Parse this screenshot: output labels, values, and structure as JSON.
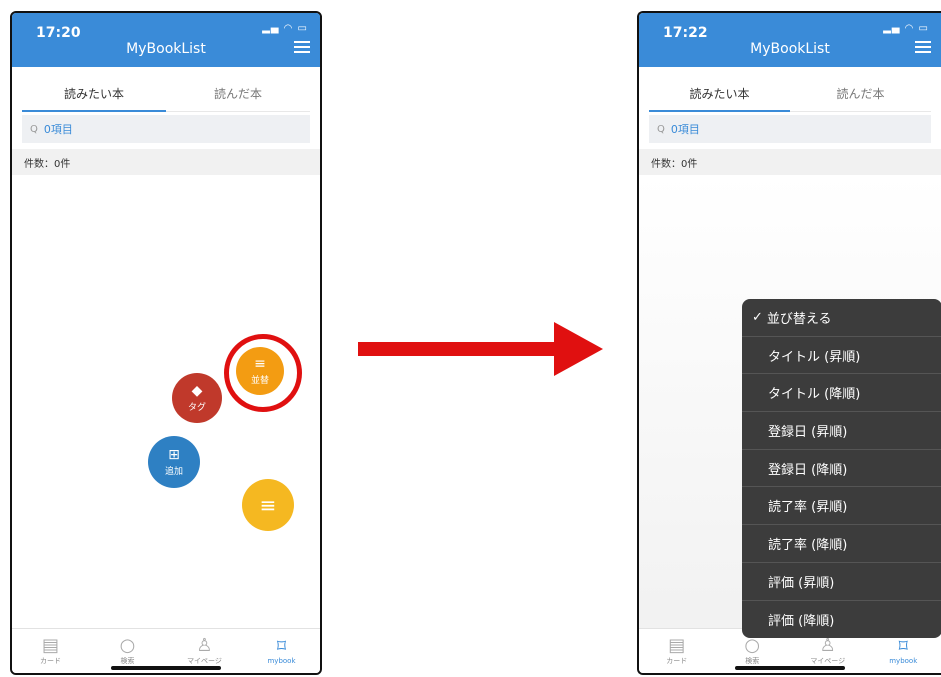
{
  "left_screen": {
    "status_time": "17:20",
    "app_title": "MyBookList",
    "tabs": [
      "読みたい本",
      "読んだ本"
    ],
    "search_text": "0項目",
    "count_text": "件数：0件",
    "fab_sort_label": "並替",
    "fab_tag_label": "タグ",
    "fab_add_label": "追加",
    "bottom_nav": [
      "カード",
      "検索",
      "マイページ",
      "mybook"
    ]
  },
  "right_screen": {
    "status_time": "17:22",
    "app_title": "MyBookList",
    "tabs": [
      "読みたい本",
      "読んだ本"
    ],
    "search_text": "0項目",
    "count_text": "件数：0件",
    "sort_menu": {
      "header": "並び替える",
      "items": [
        "タイトル (昇順)",
        "タイトル (降順)",
        "登録日 (昇順)",
        "登録日 (降順)",
        "読了率 (昇順)",
        "読了率 (降順)",
        "評価 (昇順)",
        "評価 (降順)"
      ]
    },
    "bottom_nav": [
      "カード",
      "検索",
      "マイページ",
      "mybook"
    ]
  },
  "colors": {
    "header_blue": "#3a8bd8",
    "sort_fab": "#f39c12",
    "tag_fab": "#c0392b",
    "add_fab": "#2e80c3",
    "main_fab": "#f5b821",
    "highlight_red": "#e01010",
    "arrow_red": "#e01010"
  },
  "icons": {
    "search": "search-icon",
    "menu": "hamburger-menu-icon",
    "sort": "sort-icon",
    "tag": "tag-icon",
    "add": "add-note-icon",
    "card": "card-icon",
    "person": "person-icon",
    "bookmark": "bookmark-icon"
  }
}
